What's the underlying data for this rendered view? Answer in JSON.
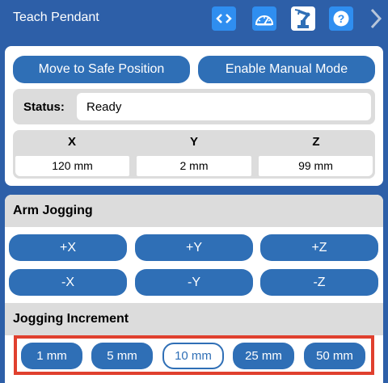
{
  "header": {
    "title": "Teach Pendant",
    "icons": [
      "code-icon",
      "gauge-icon",
      "robot-arm-icon",
      "help-icon",
      "chevron-right-icon"
    ],
    "help_glyph": "?"
  },
  "actions": {
    "safe_position_label": "Move to Safe Position",
    "manual_mode_label": "Enable Manual Mode"
  },
  "status": {
    "label": "Status:",
    "value": "Ready"
  },
  "coordinates": [
    {
      "axis": "X",
      "value": "120 mm"
    },
    {
      "axis": "Y",
      "value": "2 mm"
    },
    {
      "axis": "Z",
      "value": "99 mm"
    }
  ],
  "jogging": {
    "title": "Arm Jogging",
    "buttons": [
      "+X",
      "+Y",
      "+Z",
      "-X",
      "-Y",
      "-Z"
    ]
  },
  "increment": {
    "title": "Jogging Increment",
    "options": [
      "1 mm",
      "5 mm",
      "10 mm",
      "25 mm",
      "50 mm"
    ],
    "selected": "10 mm"
  },
  "colors": {
    "header_bg": "#2d5fa8",
    "button_blue": "#2f6fb6",
    "icon_blue": "#2f8ef0",
    "highlight_red": "#e0402e",
    "panel_gray": "#dcdcdc"
  }
}
